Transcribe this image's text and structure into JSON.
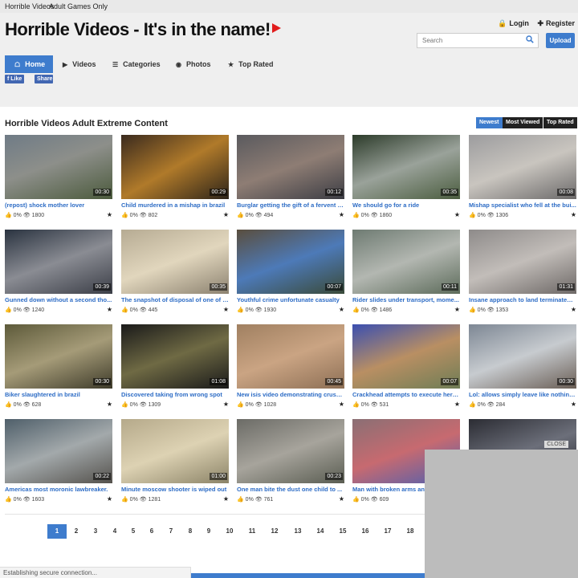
{
  "topbar": {
    "brand": "Horrible Videos",
    "link": "Adult Games Only"
  },
  "header": {
    "logo": "Horrible Videos - It's in the name!",
    "login": "Login",
    "register": "Register",
    "search_placeholder": "Search",
    "upload": "Upload"
  },
  "nav": {
    "home": "Home",
    "videos": "Videos",
    "categories": "Categories",
    "photos": "Photos",
    "top_rated": "Top Rated"
  },
  "social": {
    "like": "Like",
    "share": "Share"
  },
  "section": {
    "title": "Horrible Videos Adult Extreme Content",
    "sort": [
      "Newest",
      "Most Viewed",
      "Top Rated"
    ]
  },
  "videos": [
    {
      "title": "(repost) shock mother lover",
      "duration": "00:30",
      "rating": "0%",
      "views": "1800"
    },
    {
      "title": "Child murdered in a mishap in brazil",
      "duration": "00:29",
      "rating": "0%",
      "views": "802"
    },
    {
      "title": "Burglar getting the gift of a fervent t...",
      "duration": "00:12",
      "rating": "0%",
      "views": "494"
    },
    {
      "title": "We should go for a ride",
      "duration": "00:35",
      "rating": "0%",
      "views": "1860"
    },
    {
      "title": "Mishap specialist who fell at the bui...",
      "duration": "00:08",
      "rating": "0%",
      "views": "1306"
    },
    {
      "title": "Gunned down without a second tho...",
      "duration": "00:39",
      "rating": "0%",
      "views": "1240"
    },
    {
      "title": "The snapshot of disposal of one of t...",
      "duration": "00:35",
      "rating": "0%",
      "views": "445"
    },
    {
      "title": "Youthful crime unfortunate casualty",
      "duration": "00:07",
      "rating": "0%",
      "views": "1930"
    },
    {
      "title": "Rider slides under transport, mome...",
      "duration": "00:11",
      "rating": "0%",
      "views": "1486"
    },
    {
      "title": "Insane approach to land terminated ...",
      "duration": "01:31",
      "rating": "0%",
      "views": "1353"
    },
    {
      "title": "Biker slaughtered in brazil",
      "duration": "00:30",
      "rating": "0%",
      "views": "628"
    },
    {
      "title": "Discovered taking from wrong spot",
      "duration": "01:08",
      "rating": "0%",
      "views": "1309"
    },
    {
      "title": "New isis video demonstrating crush...",
      "duration": "00:45",
      "rating": "0%",
      "views": "1028"
    },
    {
      "title": "Crackhead attempts to execute hers...",
      "duration": "00:07",
      "rating": "0%",
      "views": "531"
    },
    {
      "title": "Lol: allows simply leave like nothing...",
      "duration": "00:30",
      "rating": "0%",
      "views": "284"
    },
    {
      "title": "Americas most moronic lawbreaker.",
      "duration": "00:22",
      "rating": "0%",
      "views": "1603"
    },
    {
      "title": "Minute moscow shooter is wiped out",
      "duration": "01:00",
      "rating": "0%",
      "views": "1281"
    },
    {
      "title": "One man bite the dust one child to ...",
      "duration": "00:23",
      "rating": "0%",
      "views": "761"
    },
    {
      "title": "Man with broken arms and",
      "duration": "",
      "rating": "0%",
      "views": "609"
    },
    {
      "title": "",
      "duration": "",
      "rating": "",
      "views": ""
    }
  ],
  "pagination": [
    "1",
    "2",
    "3",
    "4",
    "5",
    "6",
    "7",
    "8",
    "9",
    "10",
    "11",
    "12",
    "13",
    "14",
    "15",
    "16",
    "17",
    "18"
  ],
  "status": "Establishing secure connection...",
  "ad": {
    "close": "CLOSE"
  },
  "colors": {
    "accent": "#3e7ccd",
    "link": "#2d6cc5",
    "thumb_up": "#5bb034",
    "logo_play": "#e11d1d"
  }
}
